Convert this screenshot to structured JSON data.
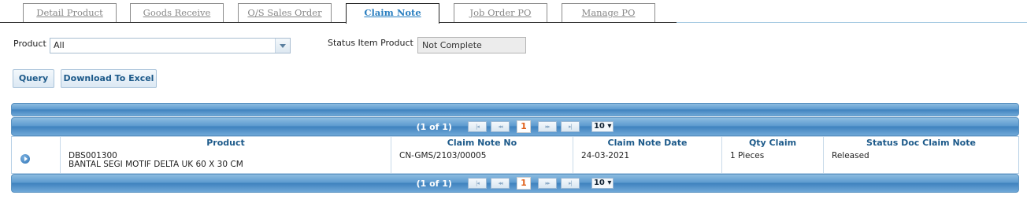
{
  "tabs": [
    {
      "label": "Detail Product",
      "active": false
    },
    {
      "label": "Goods Receive",
      "active": false
    },
    {
      "label": "O/S Sales Order",
      "active": false
    },
    {
      "label": "Claim Note",
      "active": true
    },
    {
      "label": "Job Order PO",
      "active": false
    },
    {
      "label": "Manage PO",
      "active": false
    }
  ],
  "filters": {
    "product_label": "Product",
    "product_value": "All",
    "status_label": "Status Item Product",
    "status_value": "Not Complete"
  },
  "actions": {
    "query_label": "Query",
    "excel_label": "Download To Excel"
  },
  "pager": {
    "count": "(1 of 1)",
    "current_page": "1",
    "rows_per_page": "10"
  },
  "grid": {
    "columns": [
      "Product",
      "Claim Note No",
      "Claim Note Date",
      "Qty Claim",
      "Status Doc Claim Note"
    ],
    "rows": [
      {
        "product_code": "DBS001300",
        "product_name": "BANTAL SEGI MOTIF DELTA UK 60 X 30 CM",
        "claim_note_no": "CN-GMS/2103/00005",
        "claim_note_date": "24-03-2021",
        "qty_claim": "1 Pieces",
        "status": "Released"
      }
    ]
  },
  "colors": {
    "accent": "#2a7fc0",
    "header_bar": "#4f8fc8",
    "column_text": "#1d5a8a",
    "current_page": "#e0601a"
  }
}
